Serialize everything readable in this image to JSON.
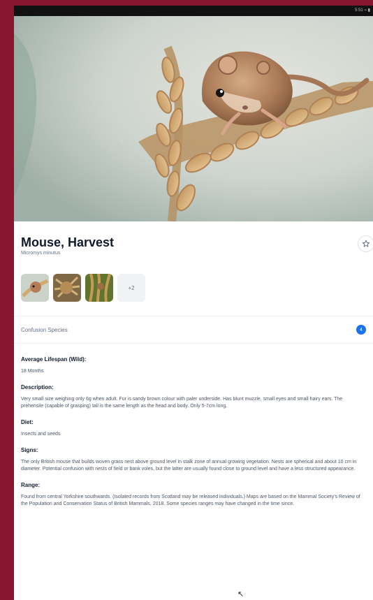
{
  "status_bar": {
    "text": "5:51 ⌁ ▮"
  },
  "hero": {
    "image": "harvest-mouse-photo"
  },
  "species": {
    "name": "Mouse, Harvest",
    "latin_name": "Micromys minutus"
  },
  "actions": {
    "favorite_icon": "star-icon"
  },
  "gallery": {
    "more_label": "+2"
  },
  "confusion_species": {
    "label": "Confusion Species",
    "count": "4"
  },
  "details": {
    "lifespan_title": "Average Lifespan (Wild):",
    "lifespan_text": "18 Months",
    "description_title": "Description:",
    "description_text": "Very small size weighing only 6g when adult. Fur is sandy brown colour with paler underside. Has blunt muzzle, small eyes and small hairy ears. The prehensile (capable of grasping) tail is the same length as the head and body. Only 5-7cm long.",
    "diet_title": "Diet:",
    "diet_text": "Insects and seeds",
    "signs_title": "Signs:",
    "signs_text": "The only British mouse that builds woven grass nest above ground level in stalk zone of annual growing vegetation. Nests are spherical and about 10 cm in diameter. Potential confusion with nests of field or bank voles, but the latter are usually found close to ground level and have a less structured appearance.",
    "range_title": "Range:",
    "range_text": "Found from central Yorkshire southwards. (Isolated records from Scotland may be released individuals.) Maps are based on the Mammal Society's Review of the Population and Conservation Status of British Mammals, 2018. Some species ranges may have changed in the time since."
  },
  "colors": {
    "outer_background": "#8a1531",
    "accent": "#1a73e8",
    "title_text": "#111a2d"
  }
}
